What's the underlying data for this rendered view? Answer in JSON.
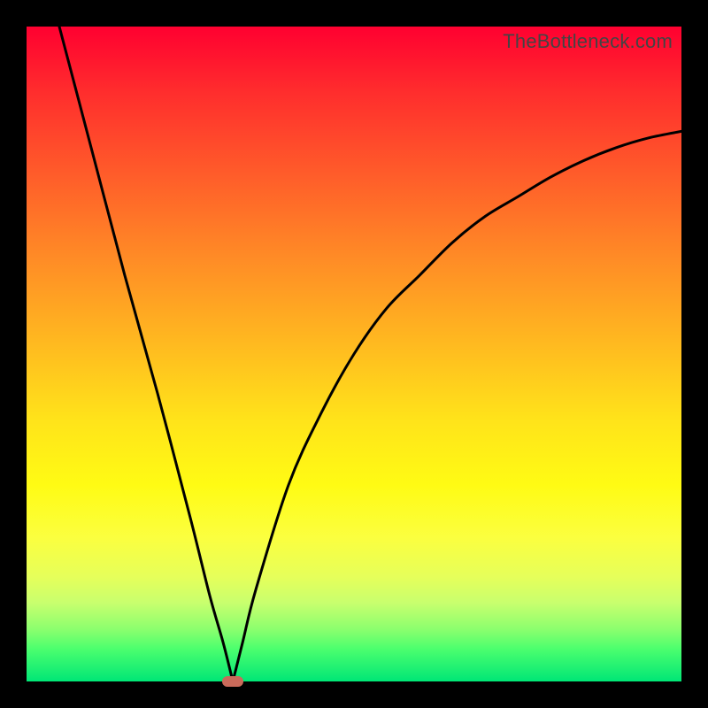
{
  "watermark": "TheBottleneck.com",
  "chart_data": {
    "type": "line",
    "title": "",
    "xlabel": "",
    "ylabel": "",
    "xlim": [
      0,
      100
    ],
    "ylim": [
      0,
      100
    ],
    "gradient_colors": {
      "top": "#ff0030",
      "mid": "#ffe31a",
      "bottom": "#00e676"
    },
    "series": [
      {
        "name": "bottleneck-curve",
        "color": "#000000",
        "x": [
          5,
          10,
          15,
          20,
          25,
          28,
          30,
          31.5,
          33,
          35,
          40,
          45,
          50,
          55,
          60,
          65,
          70,
          75,
          80,
          85,
          90,
          95,
          100
        ],
        "values": [
          100,
          81,
          62,
          44,
          25,
          13,
          6,
          0,
          6,
          14,
          30,
          41,
          50,
          57,
          62,
          67,
          71,
          74,
          77,
          79.5,
          81.5,
          83,
          84
        ]
      }
    ],
    "marker": {
      "name": "optimal-point",
      "x": 31.5,
      "y": 0,
      "color": "#c96a5a"
    }
  }
}
